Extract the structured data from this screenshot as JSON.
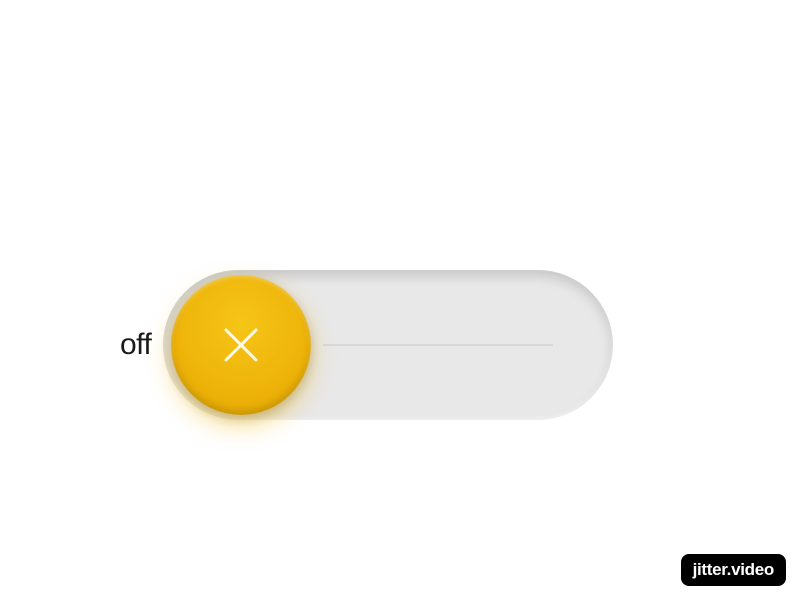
{
  "toggle": {
    "state_label": "off",
    "state": "off",
    "icon": "x-icon",
    "colors": {
      "knob": "#eeb309",
      "track": "#e8e8e8",
      "label": "#1a1a1a"
    }
  },
  "watermark": {
    "text": "jitter.video"
  }
}
